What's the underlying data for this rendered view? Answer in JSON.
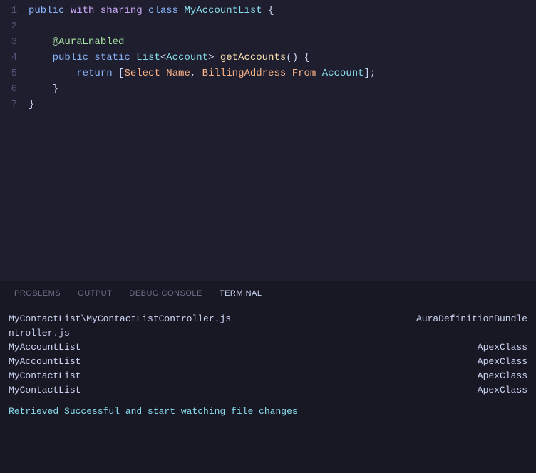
{
  "editor": {
    "lines": [
      {
        "number": "1",
        "tokens": [
          {
            "text": "public ",
            "class": "kw-blue"
          },
          {
            "text": "with ",
            "class": "kw-magenta"
          },
          {
            "text": "sharing ",
            "class": "kw-magenta"
          },
          {
            "text": "class ",
            "class": "kw-blue"
          },
          {
            "text": "MyAccountList ",
            "class": "kw-classname"
          },
          {
            "text": "{",
            "class": "kw-white"
          }
        ]
      },
      {
        "number": "2",
        "tokens": []
      },
      {
        "number": "3",
        "tokens": [
          {
            "text": "    @AuraEnabled",
            "class": "kw-green"
          }
        ]
      },
      {
        "number": "4",
        "tokens": [
          {
            "text": "    ",
            "class": "kw-white"
          },
          {
            "text": "public ",
            "class": "kw-blue"
          },
          {
            "text": "static ",
            "class": "kw-blue"
          },
          {
            "text": "List",
            "class": "kw-cyan"
          },
          {
            "text": "<",
            "class": "kw-white"
          },
          {
            "text": "Account",
            "class": "kw-cyan"
          },
          {
            "text": "> ",
            "class": "kw-white"
          },
          {
            "text": "getAccounts",
            "class": "kw-yellow"
          },
          {
            "text": "() {",
            "class": "kw-white"
          }
        ]
      },
      {
        "number": "5",
        "tokens": [
          {
            "text": "        ",
            "class": "kw-white"
          },
          {
            "text": "return ",
            "class": "kw-blue"
          },
          {
            "text": "[",
            "class": "kw-white"
          },
          {
            "text": "Select ",
            "class": "kw-orange"
          },
          {
            "text": "Name",
            "class": "kw-orange"
          },
          {
            "text": ", ",
            "class": "kw-white"
          },
          {
            "text": "BillingAddress ",
            "class": "kw-orange"
          },
          {
            "text": "From ",
            "class": "kw-orange"
          },
          {
            "text": "Account",
            "class": "kw-cyan"
          },
          {
            "text": "];",
            "class": "kw-white"
          }
        ]
      },
      {
        "number": "6",
        "tokens": [
          {
            "text": "    }",
            "class": "kw-white"
          }
        ]
      },
      {
        "number": "7",
        "tokens": [
          {
            "text": "}",
            "class": "kw-white"
          }
        ]
      }
    ]
  },
  "panel": {
    "tabs": [
      {
        "label": "PROBLEMS",
        "active": false
      },
      {
        "label": "OUTPUT",
        "active": false
      },
      {
        "label": "DEBUG CONSOLE",
        "active": false
      },
      {
        "label": "TERMINAL",
        "active": true
      }
    ],
    "terminal": {
      "rows": [
        {
          "left": "MyContactList\\MyContactListController.js",
          "right": "AuraDefinitionBundle"
        },
        {
          "left": "ntroller.js",
          "right": ""
        },
        {
          "left": "MyAccountList",
          "right": "ApexClass"
        },
        {
          "left": "MyAccountList",
          "right": "ApexClass"
        },
        {
          "left": "MyContactList",
          "right": "ApexClass"
        },
        {
          "left": "MyContactList",
          "right": "ApexClass"
        }
      ],
      "success_message": "Retrieved Successful and start watching file changes"
    }
  }
}
